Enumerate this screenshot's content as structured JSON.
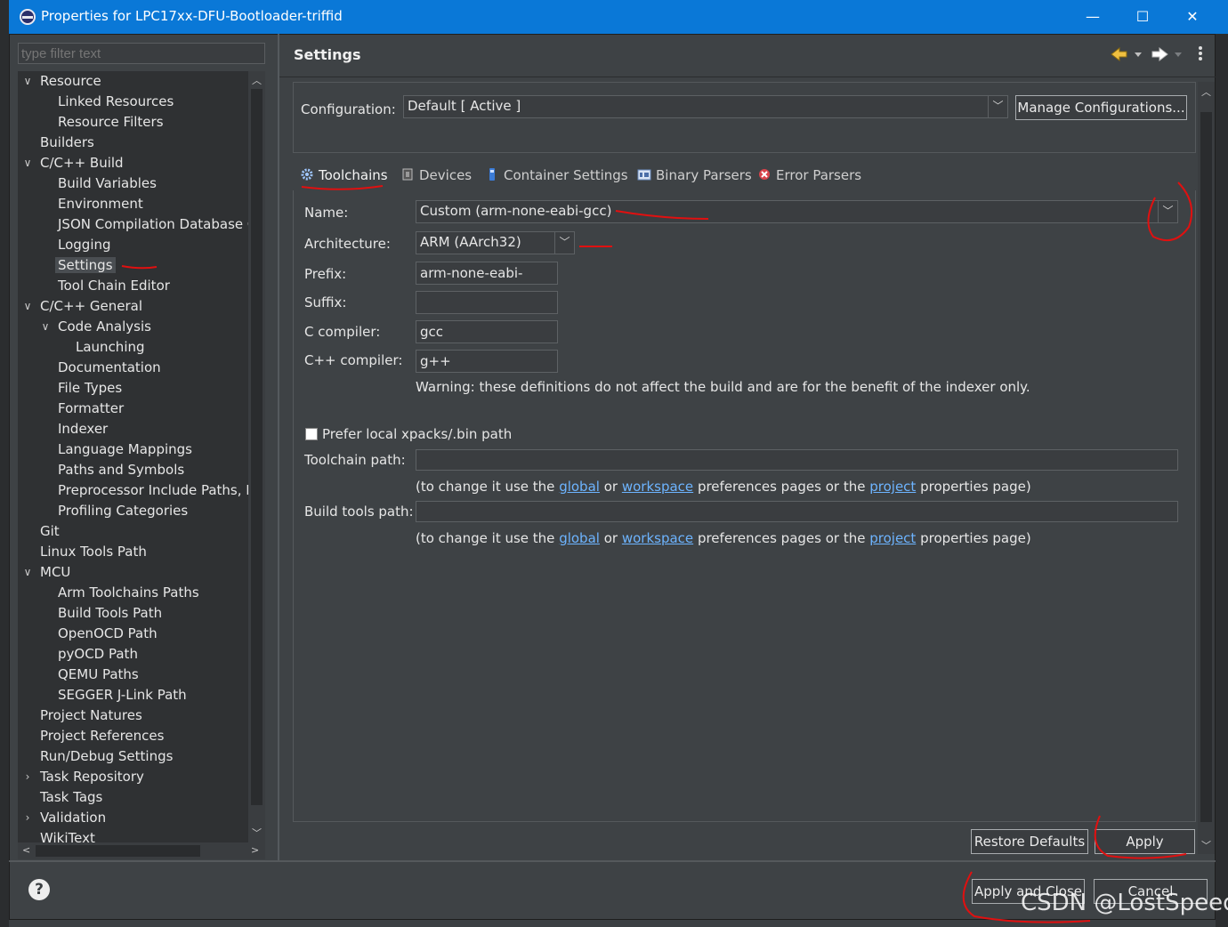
{
  "window": {
    "title": "Properties for LPC17xx-DFU-Bootloader-triffid",
    "minimize": "—",
    "maximize": "☐",
    "close": "✕"
  },
  "filter": {
    "placeholder": "type filter text"
  },
  "tree": [
    {
      "label": "Resource",
      "level": 0,
      "expander": "open"
    },
    {
      "label": "Linked Resources",
      "level": 1
    },
    {
      "label": "Resource Filters",
      "level": 1
    },
    {
      "label": "Builders",
      "level": 0
    },
    {
      "label": "C/C++ Build",
      "level": 0,
      "expander": "open"
    },
    {
      "label": "Build Variables",
      "level": 1
    },
    {
      "label": "Environment",
      "level": 1
    },
    {
      "label": "JSON Compilation Database G",
      "level": 1
    },
    {
      "label": "Logging",
      "level": 1
    },
    {
      "label": "Settings",
      "level": 1,
      "selected": true
    },
    {
      "label": "Tool Chain Editor",
      "level": 1
    },
    {
      "label": "C/C++ General",
      "level": 0,
      "expander": "open"
    },
    {
      "label": "Code Analysis",
      "level": 1,
      "expander": "open"
    },
    {
      "label": "Launching",
      "level": 2
    },
    {
      "label": "Documentation",
      "level": 1
    },
    {
      "label": "File Types",
      "level": 1
    },
    {
      "label": "Formatter",
      "level": 1
    },
    {
      "label": "Indexer",
      "level": 1
    },
    {
      "label": "Language Mappings",
      "level": 1
    },
    {
      "label": "Paths and Symbols",
      "level": 1
    },
    {
      "label": "Preprocessor Include Paths, M",
      "level": 1
    },
    {
      "label": "Profiling Categories",
      "level": 1
    },
    {
      "label": "Git",
      "level": 0
    },
    {
      "label": "Linux Tools Path",
      "level": 0
    },
    {
      "label": "MCU",
      "level": 0,
      "expander": "open"
    },
    {
      "label": "Arm Toolchains Paths",
      "level": 1
    },
    {
      "label": "Build Tools Path",
      "level": 1
    },
    {
      "label": "OpenOCD Path",
      "level": 1
    },
    {
      "label": "pyOCD Path",
      "level": 1
    },
    {
      "label": "QEMU Paths",
      "level": 1
    },
    {
      "label": "SEGGER J-Link Path",
      "level": 1
    },
    {
      "label": "Project Natures",
      "level": 0
    },
    {
      "label": "Project References",
      "level": 0
    },
    {
      "label": "Run/Debug Settings",
      "level": 0
    },
    {
      "label": "Task Repository",
      "level": 0,
      "expander": "closed"
    },
    {
      "label": "Task Tags",
      "level": 0
    },
    {
      "label": "Validation",
      "level": 0,
      "expander": "closed"
    },
    {
      "label": "WikiText",
      "level": 0
    }
  ],
  "page": {
    "title": "Settings",
    "configuration_label": "Configuration:",
    "configuration_value": "Default  [ Active ]",
    "manage_button": "Manage Configurations..."
  },
  "tabs": [
    {
      "label": "Toolchains",
      "icon": "gear-icon",
      "active": true
    },
    {
      "label": "Devices",
      "icon": "chip-icon"
    },
    {
      "label": "Container Settings",
      "icon": "container-icon"
    },
    {
      "label": "Binary Parsers",
      "icon": "binary-icon"
    },
    {
      "label": "Error Parsers",
      "icon": "error-icon"
    }
  ],
  "toolchain": {
    "name_label": "Name:",
    "name_value": "Custom (arm-none-eabi-gcc)",
    "arch_label": "Architecture:",
    "arch_value": "ARM (AArch32)",
    "prefix_label": "Prefix:",
    "prefix_value": "arm-none-eabi-",
    "suffix_label": "Suffix:",
    "suffix_value": "",
    "c_label": "C compiler:",
    "c_value": "gcc",
    "cpp_label": "C++ compiler:",
    "cpp_value": "g++",
    "warning": "Warning: these definitions do not affect the build and are for the benefit of the indexer only.",
    "prefer_label": "Prefer local xpacks/.bin path",
    "toolchain_path_label": "Toolchain path:",
    "build_tools_label": "Build tools path:",
    "hint_pre": "(to change it use the",
    "hint_global": "global",
    "hint_or": "or",
    "hint_workspace": "workspace",
    "hint_mid": "preferences pages or the",
    "hint_project": "project",
    "hint_post": "properties page)"
  },
  "buttons": {
    "restore": "Restore Defaults",
    "apply": "Apply",
    "apply_close": "Apply and Close",
    "cancel": "Cancel",
    "help": "?"
  },
  "watermark": "CSDN @LostSpeed"
}
